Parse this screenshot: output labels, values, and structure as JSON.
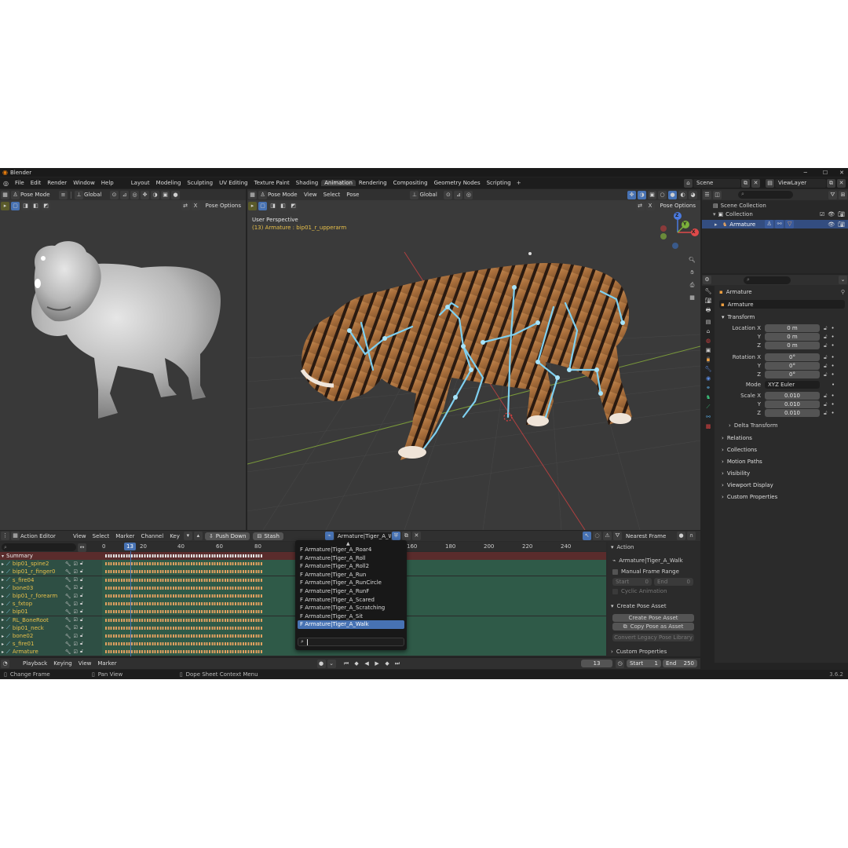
{
  "window": {
    "title": "Blender",
    "version": "3.6.2"
  },
  "menu": [
    "File",
    "Edit",
    "Render",
    "Window",
    "Help"
  ],
  "workspace_tabs": [
    "Layout",
    "Modeling",
    "Sculpting",
    "UV Editing",
    "Texture Paint",
    "Shading",
    "Animation",
    "Rendering",
    "Compositing",
    "Geometry Nodes",
    "Scripting"
  ],
  "active_tab": "Animation",
  "scene": {
    "name": "Scene",
    "view_layer": "ViewLayer"
  },
  "left_viewport": {
    "mode": "Pose Mode",
    "orientation": "Global",
    "pose_options": "Pose Options"
  },
  "main_viewport": {
    "mode": "Pose Mode",
    "menus": [
      "View",
      "Select",
      "Pose"
    ],
    "orientation": "Global",
    "pose_options": "Pose Options",
    "overlay_title": "User Perspective",
    "overlay_subtitle": "(13) Armature : bip01_r_upperarm",
    "gizmo_axes": [
      "X",
      "Y",
      "Z"
    ]
  },
  "outliner": {
    "items": [
      {
        "label": "Scene Collection"
      },
      {
        "label": "Collection"
      },
      {
        "label": "Armature"
      }
    ]
  },
  "properties": {
    "object": "Armature",
    "object_field": "Armature",
    "transform_header": "Transform",
    "location_label": "Location X",
    "rotation_label": "Rotation X",
    "scale_label": "Scale X",
    "axes_yz": [
      "Y",
      "Z"
    ],
    "location": [
      "0 m",
      "0 m",
      "0 m"
    ],
    "rotation": [
      "0°",
      "0°",
      "0°"
    ],
    "mode_label": "Mode",
    "mode_value": "XYZ Euler",
    "scale": [
      "0.010",
      "0.010",
      "0.010"
    ],
    "delta_transform": "Delta Transform",
    "sections": [
      "Relations",
      "Collections",
      "Motion Paths",
      "Visibility",
      "Viewport Display",
      "Custom Properties"
    ]
  },
  "action_editor": {
    "editor_type": "Action Editor",
    "menus": [
      "View",
      "Select",
      "Marker",
      "Channel",
      "Key"
    ],
    "push_down": "Push Down",
    "stash": "Stash",
    "action_name": "Armature|Tiger_A_Walk",
    "snap": "Nearest Frame",
    "current_frame": "13",
    "frame_ticks": [
      "0",
      "20",
      "40",
      "60",
      "80",
      "160",
      "180",
      "200",
      "220",
      "240"
    ],
    "channels": [
      "Summary",
      "bip01_spine2",
      "bip01_r_finger0",
      "s_fire04",
      "bone03",
      "bip01_r_forearm",
      "s_fxtop",
      "bip01",
      "RL_BoneRoot",
      "bip01_neck",
      "bone02",
      "s_fire01",
      "Armature"
    ]
  },
  "action_dropdown": {
    "items": [
      "F Armature|Tiger_A_Roar4",
      "F Armature|Tiger_A_Roll",
      "F Armature|Tiger_A_Roll2",
      "F Armature|Tiger_A_Run",
      "F Armature|Tiger_A_RunCircle",
      "F Armature|Tiger_A_RunF",
      "F Armature|Tiger_A_Scared",
      "F Armature|Tiger_A_Scratching",
      "F Armature|Tiger_A_Sit",
      "F Armature|Tiger_A_Walk"
    ],
    "selected_index": 9
  },
  "action_sidebar": {
    "action_header": "Action",
    "action_name": "Armature|Tiger_A_Walk",
    "manual_frame_range": "Manual Frame Range",
    "start_label": "Start",
    "start_value": "0",
    "end_label": "End",
    "end_value": "0",
    "cyclic": "Cyclic Animation",
    "pose_asset_header": "Create Pose Asset",
    "create_pose_asset": "Create Pose Asset",
    "copy_pose": "Copy Pose as Asset",
    "convert_legacy": "Convert Legacy Pose Library",
    "custom_properties": "Custom Properties"
  },
  "timeline": {
    "menus": [
      "Playback",
      "Keying",
      "View",
      "Marker"
    ],
    "current_frame": "13",
    "start_label": "Start",
    "start_value": "1",
    "end_label": "End",
    "end_value": "250"
  },
  "status_bar": {
    "items": [
      "Change Frame",
      "Pan View",
      "Dope Sheet Context Menu"
    ]
  },
  "colors": {
    "accent": "#4772b3",
    "active_tab": "#3d3d3d",
    "keyframe": "#e0a060",
    "channel_bg": "#2f5a48"
  }
}
